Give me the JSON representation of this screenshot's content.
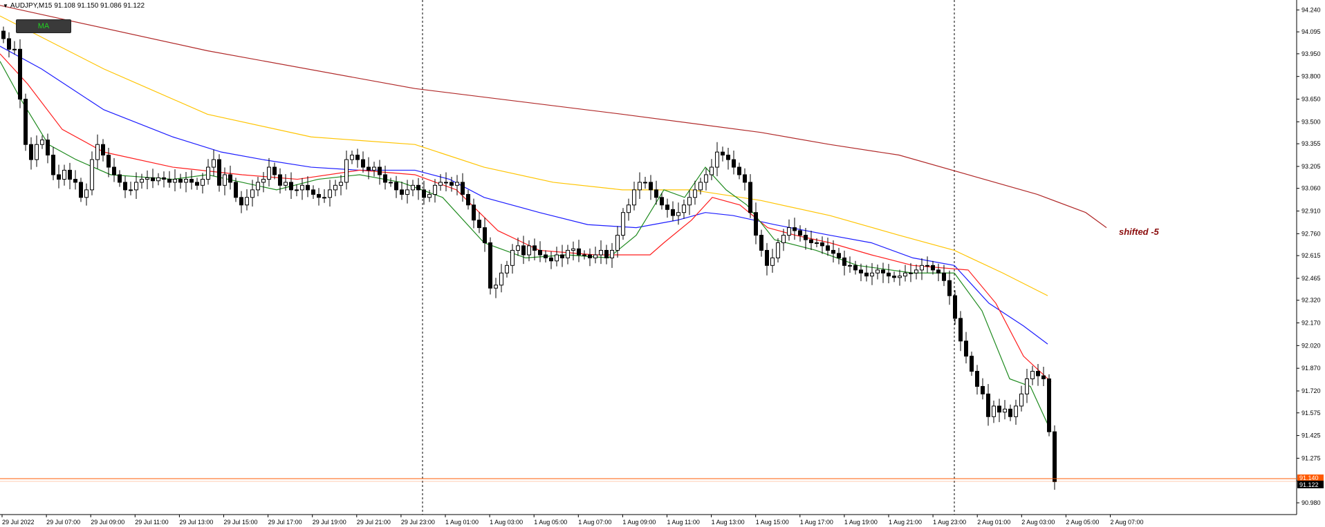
{
  "header": {
    "symbol": "AUDJPY,M15",
    "ohlc": "91.108 91.150 91.086 91.122"
  },
  "ma_button": {
    "label": "MA"
  },
  "annotation": "shifted  -5",
  "colors": {
    "background": "#ffffff",
    "ma_green": "#1e8a1e",
    "ma_red": "#ff1c1c",
    "ma_blue": "#1c1cff",
    "ma_gold": "#ffc400",
    "ma_darkred": "#b02828",
    "price_line_orange": "#ff5a00",
    "current_price_label_bg": "#000000",
    "orange_label_bg": "#ff5a00"
  },
  "chart_data": {
    "type": "candlestick",
    "ylim": [
      90.98,
      94.26
    ],
    "y_ticks": [
      "94.240",
      "94.095",
      "93.950",
      "93.800",
      "93.650",
      "93.500",
      "93.355",
      "93.205",
      "93.060",
      "92.910",
      "92.760",
      "92.615",
      "92.465",
      "92.320",
      "92.170",
      "92.020",
      "91.870",
      "91.720",
      "91.575",
      "91.425",
      "91.275",
      "91.125",
      "90.980"
    ],
    "x_ticks": [
      "29 Jul 2022",
      "29 Jul 07:00",
      "29 Jul 09:00",
      "29 Jul 11:00",
      "29 Jul 13:00",
      "29 Jul 15:00",
      "29 Jul 17:00",
      "29 Jul 19:00",
      "29 Jul 21:00",
      "29 Jul 23:00",
      "1 Aug 01:00",
      "1 Aug 03:00",
      "1 Aug 05:00",
      "1 Aug 07:00",
      "1 Aug 09:00",
      "1 Aug 11:00",
      "1 Aug 13:00",
      "1 Aug 15:00",
      "1 Aug 17:00",
      "1 Aug 19:00",
      "1 Aug 21:00",
      "1 Aug 23:00",
      "2 Aug 01:00",
      "2 Aug 03:00",
      "2 Aug 05:00",
      "2 Aug 07:00"
    ],
    "current_price": "91.122",
    "orange_price": "91.140",
    "period_separators": [
      "29 Jul 23:00",
      "1 Aug 23:00"
    ],
    "close_path": [
      94.05,
      93.98,
      93.98,
      93.65,
      93.35,
      93.25,
      93.35,
      93.38,
      93.28,
      93.15,
      93.12,
      93.18,
      93.12,
      93.1,
      93.0,
      93.05,
      93.25,
      93.35,
      93.28,
      93.2,
      93.15,
      93.1,
      93.05,
      93.05,
      93.1,
      93.12,
      93.13,
      93.11,
      93.13,
      93.12,
      93.1,
      93.12,
      93.1,
      93.12,
      93.1,
      93.08,
      93.12,
      93.2,
      93.25,
      93.08,
      93.15,
      93.1,
      93.0,
      92.95,
      93.0,
      93.05,
      93.1,
      93.12,
      93.2,
      93.15,
      93.08,
      93.1,
      93.05,
      93.05,
      93.08,
      93.05,
      93.02,
      93.0,
      93.0,
      93.05,
      93.08,
      93.1,
      93.25,
      93.28,
      93.25,
      93.2,
      93.18,
      93.2,
      93.15,
      93.1,
      93.1,
      93.05,
      93.02,
      93.05,
      93.08,
      93.05,
      93.0,
      93.02,
      93.08,
      93.1,
      93.1,
      93.08,
      93.1,
      93.02,
      92.95,
      92.85,
      92.8,
      92.7,
      92.4,
      92.42,
      92.5,
      92.55,
      92.65,
      92.68,
      92.62,
      92.68,
      92.65,
      92.62,
      92.6,
      92.58,
      92.62,
      92.6,
      92.65,
      92.66,
      92.62,
      92.62,
      92.6,
      92.62,
      92.65,
      92.6,
      92.65,
      92.75,
      92.9,
      92.95,
      93.05,
      93.1,
      93.1,
      93.05,
      93.0,
      92.95,
      92.92,
      92.88,
      92.9,
      92.95,
      93.0,
      93.05,
      93.1,
      93.15,
      93.2,
      93.3,
      93.28,
      93.25,
      93.2,
      93.15,
      93.1,
      92.9,
      92.75,
      92.65,
      92.55,
      92.6,
      92.7,
      92.75,
      92.8,
      92.78,
      92.75,
      92.72,
      92.7,
      92.7,
      92.68,
      92.65,
      92.63,
      92.6,
      92.55,
      92.55,
      92.52,
      92.5,
      92.48,
      92.5,
      92.52,
      92.5,
      92.48,
      92.47,
      92.48,
      92.5,
      92.5,
      92.52,
      92.55,
      92.55,
      92.52,
      92.5,
      92.45,
      92.35,
      92.2,
      92.05,
      91.95,
      91.85,
      91.75,
      91.7,
      91.55,
      91.62,
      91.58,
      91.6,
      91.55,
      91.62,
      91.7,
      91.8,
      91.85,
      91.82,
      91.8,
      91.45,
      91.12
    ],
    "moving_averages": [
      {
        "color": "#b02828",
        "values": [
          [
            0,
            94.27
          ],
          [
            300,
            93.97
          ],
          [
            600,
            93.72
          ],
          [
            900,
            93.55
          ],
          [
            1100,
            93.43
          ],
          [
            1200,
            93.35
          ],
          [
            1300,
            93.28
          ],
          [
            1400,
            93.15
          ],
          [
            1500,
            93.02
          ],
          [
            1570,
            92.9
          ],
          [
            1600,
            92.8
          ]
        ]
      },
      {
        "color": "#ffc400",
        "values": [
          [
            0,
            94.2
          ],
          [
            150,
            93.85
          ],
          [
            300,
            93.55
          ],
          [
            450,
            93.4
          ],
          [
            600,
            93.35
          ],
          [
            700,
            93.2
          ],
          [
            800,
            93.1
          ],
          [
            900,
            93.05
          ],
          [
            1000,
            93.05
          ],
          [
            1100,
            92.98
          ],
          [
            1200,
            92.88
          ],
          [
            1300,
            92.75
          ],
          [
            1380,
            92.65
          ],
          [
            1450,
            92.5
          ],
          [
            1515,
            92.35
          ]
        ]
      },
      {
        "color": "#1c1cff",
        "values": [
          [
            0,
            94.0
          ],
          [
            60,
            93.85
          ],
          [
            150,
            93.58
          ],
          [
            250,
            93.4
          ],
          [
            320,
            93.3
          ],
          [
            380,
            93.25
          ],
          [
            450,
            93.2
          ],
          [
            520,
            93.18
          ],
          [
            600,
            93.18
          ],
          [
            650,
            93.12
          ],
          [
            700,
            93.0
          ],
          [
            780,
            92.9
          ],
          [
            850,
            92.82
          ],
          [
            920,
            92.8
          ],
          [
            980,
            92.85
          ],
          [
            1020,
            92.9
          ],
          [
            1060,
            92.88
          ],
          [
            1120,
            92.82
          ],
          [
            1200,
            92.75
          ],
          [
            1260,
            92.7
          ],
          [
            1320,
            92.6
          ],
          [
            1380,
            92.55
          ],
          [
            1430,
            92.3
          ],
          [
            1480,
            92.15
          ],
          [
            1515,
            92.03
          ]
        ]
      },
      {
        "color": "#ff1c1c",
        "values": [
          [
            0,
            93.95
          ],
          [
            40,
            93.75
          ],
          [
            90,
            93.45
          ],
          [
            150,
            93.3
          ],
          [
            250,
            93.2
          ],
          [
            350,
            93.15
          ],
          [
            430,
            93.12
          ],
          [
            520,
            93.18
          ],
          [
            600,
            93.15
          ],
          [
            660,
            93.05
          ],
          [
            720,
            92.78
          ],
          [
            780,
            92.65
          ],
          [
            860,
            92.62
          ],
          [
            940,
            92.62
          ],
          [
            960,
            92.7
          ],
          [
            1000,
            92.85
          ],
          [
            1030,
            93.0
          ],
          [
            1070,
            92.95
          ],
          [
            1110,
            92.8
          ],
          [
            1150,
            92.75
          ],
          [
            1200,
            92.7
          ],
          [
            1260,
            92.62
          ],
          [
            1320,
            92.55
          ],
          [
            1400,
            92.52
          ],
          [
            1440,
            92.3
          ],
          [
            1480,
            91.95
          ],
          [
            1520,
            91.78
          ]
        ]
      },
      {
        "color": "#1e8a1e",
        "values": [
          [
            0,
            93.9
          ],
          [
            30,
            93.65
          ],
          [
            70,
            93.35
          ],
          [
            110,
            93.25
          ],
          [
            160,
            93.15
          ],
          [
            250,
            93.12
          ],
          [
            300,
            93.15
          ],
          [
            350,
            93.1
          ],
          [
            400,
            93.05
          ],
          [
            460,
            93.12
          ],
          [
            520,
            93.15
          ],
          [
            580,
            93.1
          ],
          [
            640,
            93.0
          ],
          [
            700,
            92.7
          ],
          [
            760,
            92.6
          ],
          [
            820,
            92.62
          ],
          [
            880,
            92.6
          ],
          [
            920,
            92.75
          ],
          [
            960,
            93.05
          ],
          [
            990,
            93.0
          ],
          [
            1020,
            93.2
          ],
          [
            1050,
            93.05
          ],
          [
            1080,
            92.95
          ],
          [
            1120,
            92.72
          ],
          [
            1180,
            92.65
          ],
          [
            1240,
            92.55
          ],
          [
            1320,
            92.5
          ],
          [
            1380,
            92.5
          ],
          [
            1420,
            92.25
          ],
          [
            1460,
            91.8
          ],
          [
            1490,
            91.75
          ],
          [
            1520,
            91.45
          ]
        ]
      }
    ]
  }
}
